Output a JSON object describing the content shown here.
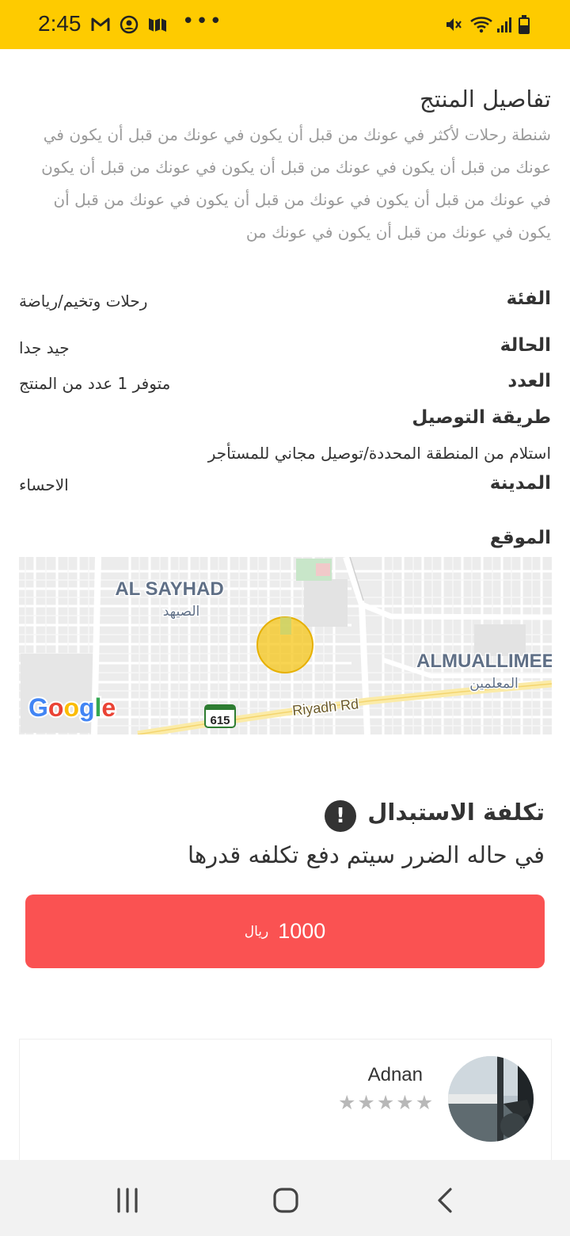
{
  "status_bar": {
    "time": "2:45",
    "more": "•••",
    "icons": [
      "gmail-icon",
      "account-circle-icon",
      "maps-icon",
      "mute-icon",
      "wifi-icon",
      "signal-icon",
      "battery-icon"
    ]
  },
  "product": {
    "section_title": "تفاصيل المنتج",
    "description": "شنطة رحلات لأكثر في عونك من قبل أن يكون في عونك من قبل أن يكون في عونك من قبل أن يكون في عونك من قبل أن يكون في عونك من قبل أن يكون في عونك من قبل أن يكون في عونك من قبل أن يكون في عونك من قبل أن يكون في عونك من قبل أن يكون في عونك من"
  },
  "details": {
    "category_label": "الفئة",
    "category_value": "رحلات وتخيم/رياضة",
    "condition_label": "الحالة",
    "condition_value": "جيد جدا",
    "quantity_label": "العدد",
    "quantity_value": "متوفر 1 عدد من المنتج",
    "delivery_label": "طريقة التوصيل",
    "delivery_value": "استلام من المنطقة المحددة/توصيل مجاني للمستأجر",
    "city_label": "المدينة",
    "city_value": "الاحساء",
    "location_label": "الموقع"
  },
  "map": {
    "district_1_en": "AL SAYHAD",
    "district_1_ar": "الصيهد",
    "district_2_en": "ALMUALLIMEE",
    "district_2_ar": "المعلمين",
    "road": "Riyadh Rd",
    "route_number": "615",
    "google": [
      "G",
      "o",
      "o",
      "g",
      "l",
      "e"
    ],
    "google_colors": [
      "#4285F4",
      "#EA4335",
      "#FBBC05",
      "#4285F4",
      "#34A853",
      "#EA4335"
    ],
    "area_color": "#f5c518"
  },
  "replacement": {
    "title": "تكلفة الاستبدال",
    "icon": "!",
    "subtitle": "في حاله الضرر سيتم دفع تكلفه قدرها",
    "amount": "1000",
    "currency": "ريال",
    "button_color": "#fa5252"
  },
  "owner": {
    "name": "Adnan",
    "rating": 0,
    "stars": [
      "★",
      "★",
      "★",
      "★",
      "★"
    ]
  },
  "nav": {
    "recents": "recents-icon",
    "home": "home-icon",
    "back": "back-icon"
  },
  "colors": {
    "status_bar": "#fecb00",
    "accent_red": "#fa5252"
  }
}
